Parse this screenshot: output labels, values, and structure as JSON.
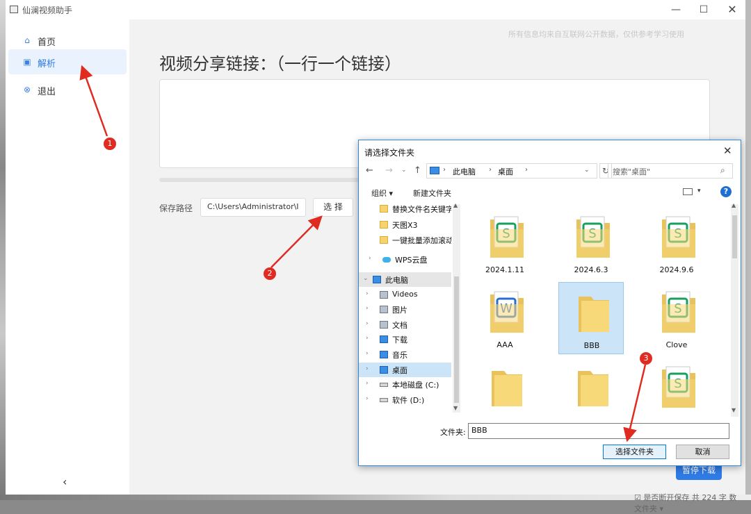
{
  "window": {
    "title": "仙澜视频助手",
    "minimize": "—",
    "maximize": "☐",
    "close": "✕"
  },
  "sidebar": {
    "items": [
      {
        "label": "首页",
        "icon": "home-icon",
        "glyph": "⌂"
      },
      {
        "label": "解析",
        "icon": "parse-icon",
        "glyph": "▣"
      },
      {
        "label": "退出",
        "icon": "exit-icon",
        "glyph": "⊗"
      }
    ],
    "collapse": "‹"
  },
  "main": {
    "notice": "所有信息均来自互联网公开数据，仅供参考学习使用",
    "heading": "视频分享链接：（一行一个链接）",
    "save_label": "保存路径",
    "save_path": "C:\\Users\\Administrator\\I",
    "select_button": "选 择",
    "pause_button": "暂停下载",
    "bottom_status": "☑ 是否断开保存      共 224 字      数 文件夹 ▾"
  },
  "dialog": {
    "title": "请选择文件夹",
    "close": "✕",
    "address": {
      "sep": "›",
      "parts": [
        "此电脑",
        "桌面"
      ],
      "dropdown": "⌄"
    },
    "refresh": "↻",
    "search_placeholder": "搜索\"桌面\"",
    "toolbar": {
      "organize": "组织 ▾",
      "new_folder": "新建文件夹",
      "view_dropdown": "▾",
      "help": "?"
    },
    "tree": [
      {
        "label": "替换文件名关键字",
        "type": "folder"
      },
      {
        "label": "天图X3",
        "type": "folder"
      },
      {
        "label": "一键批量添加滚动",
        "type": "folder"
      },
      {
        "label": "WPS云盘",
        "type": "cloud"
      },
      {
        "label": "此电脑",
        "type": "pc"
      },
      {
        "label": "Videos",
        "type": "videos"
      },
      {
        "label": "图片",
        "type": "pictures"
      },
      {
        "label": "文档",
        "type": "documents"
      },
      {
        "label": "下载",
        "type": "downloads"
      },
      {
        "label": "音乐",
        "type": "music"
      },
      {
        "label": "桌面",
        "type": "desktop"
      },
      {
        "label": "本地磁盘 (C:)",
        "type": "drive"
      },
      {
        "label": "软件 (D:)",
        "type": "drive"
      }
    ],
    "files": [
      {
        "name": "2024.1.11",
        "kind": "wps-sheet"
      },
      {
        "name": "2024.6.3",
        "kind": "wps-sheet"
      },
      {
        "name": "2024.9.6",
        "kind": "wps-sheet"
      },
      {
        "name": "AAA",
        "kind": "wps-doc"
      },
      {
        "name": "BBB",
        "kind": "folder"
      },
      {
        "name": "Clove",
        "kind": "wps-sheet"
      },
      {
        "name": "",
        "kind": "folder"
      },
      {
        "name": "",
        "kind": "folder"
      },
      {
        "name": "",
        "kind": "wps-sheet"
      }
    ],
    "folder_label": "文件夹:",
    "folder_value": "BBB",
    "ok_button": "选择文件夹",
    "cancel_button": "取消"
  },
  "annotations": [
    "1",
    "2",
    "3"
  ],
  "colors": {
    "accent": "#2f7be5",
    "arrow": "#e02b20",
    "dialog_border": "#2e8ad9"
  }
}
